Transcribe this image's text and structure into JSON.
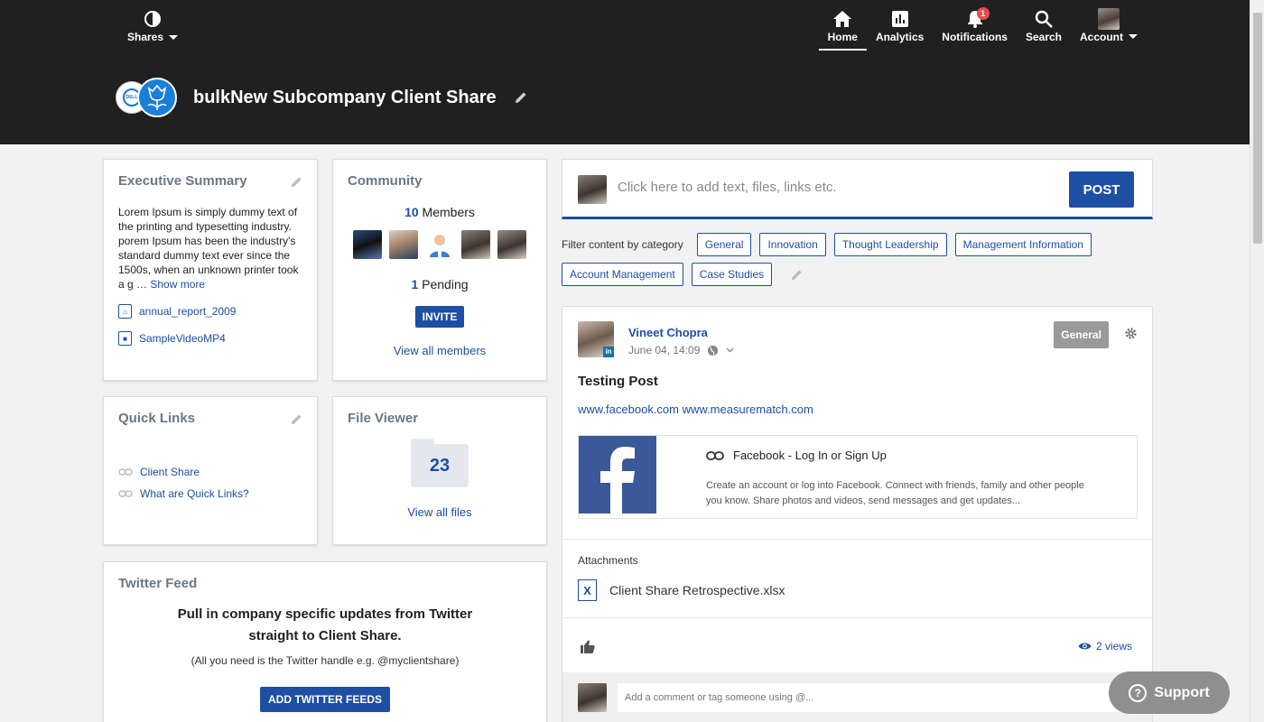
{
  "header": {
    "shares_label": "Shares",
    "share_title": "bulkNew Subcompany Client Share",
    "logo_a_text": "DELL",
    "nav": [
      {
        "label": "Home",
        "icon": "home-icon"
      },
      {
        "label": "Analytics",
        "icon": "analytics-icon"
      },
      {
        "label": "Notifications",
        "icon": "bell-icon",
        "badge": "1"
      },
      {
        "label": "Search",
        "icon": "search-icon"
      },
      {
        "label": "Account",
        "icon": "avatar"
      }
    ]
  },
  "exec_summary": {
    "title": "Executive Summary",
    "text": "Lorem Ipsum is simply dummy text of the printing and typesetting industry. porem Ipsum has been the industry's standard dummy text ever since the 1500s, when an unknown printer took a g …",
    "show_more": "Show more",
    "files": [
      "annual_report_2009",
      "SampleVideoMP4"
    ]
  },
  "community": {
    "title": "Community",
    "member_count": "10",
    "members_label": "Members",
    "pending_count": "1",
    "pending_label": "Pending",
    "invite_label": "INVITE",
    "view_all": "View all members"
  },
  "quick_links": {
    "title": "Quick Links",
    "links": [
      "Client Share",
      "What are Quick Links?"
    ]
  },
  "file_viewer": {
    "title": "File Viewer",
    "count": "23",
    "view_all": "View all files"
  },
  "twitter": {
    "title": "Twitter Feed",
    "line1": "Pull in company specific updates from Twitter",
    "line2": "straight to Client Share.",
    "note": "(All you need is the Twitter handle e.g. @myclientshare)",
    "button": "ADD TWITTER FEEDS"
  },
  "composer": {
    "placeholder": "Click here to add text, files, links etc.",
    "post_label": "POST"
  },
  "filter": {
    "label": "Filter content by category",
    "categories": [
      "General",
      "Innovation",
      "Thought Leadership",
      "Management Information",
      "Account Management",
      "Case Studies"
    ]
  },
  "post": {
    "author": "Vineet Chopra",
    "date": "June 04, 14:09",
    "category": "General",
    "title": "Testing Post",
    "link1": "www.facebook.com",
    "link2": "www.measurematch.com",
    "preview_title": "Facebook - Log In or Sign Up",
    "preview_desc": "Create an account or log into Facebook. Connect with friends, family and other people you know. Share photos and videos, send messages and get updates...",
    "attachments_label": "Attachments",
    "attachment_file": "Client Share Retrospective.xlsx",
    "views": "2 views",
    "comment_placeholder": "Add a comment or tag someone using @..."
  },
  "support_label": "Support",
  "colors": {
    "header_bg": "#202020",
    "accent": "#1d4fa3",
    "facebook": "#3b5998",
    "notification_badge": "#e74c4c"
  }
}
